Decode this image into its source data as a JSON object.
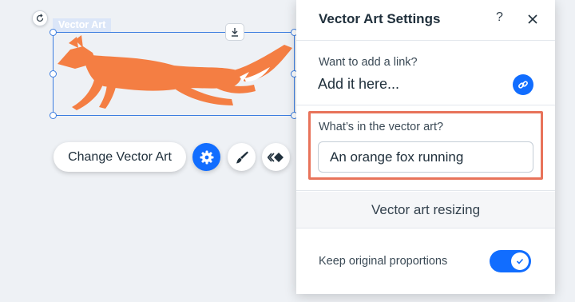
{
  "editor": {
    "element_tag": "Vector Art",
    "accent_color": "#116dff",
    "fox_color": "#f47e43",
    "toolbar": {
      "change_label": "Change Vector Art",
      "settings_icon": "gear-icon",
      "design_icon": "brush-icon",
      "animation_icon": "animation-icon"
    }
  },
  "panel": {
    "title": "Vector Art Settings",
    "help_label": "?",
    "link": {
      "label": "Want to add a link?",
      "value": "Add it here..."
    },
    "alt_text": {
      "label": "What’s in the vector art?",
      "value": "An orange fox running",
      "highlight_color": "#e8735a"
    },
    "resizing": {
      "label": "Vector art resizing"
    },
    "proportions": {
      "label": "Keep original proportions",
      "enabled": true
    }
  }
}
